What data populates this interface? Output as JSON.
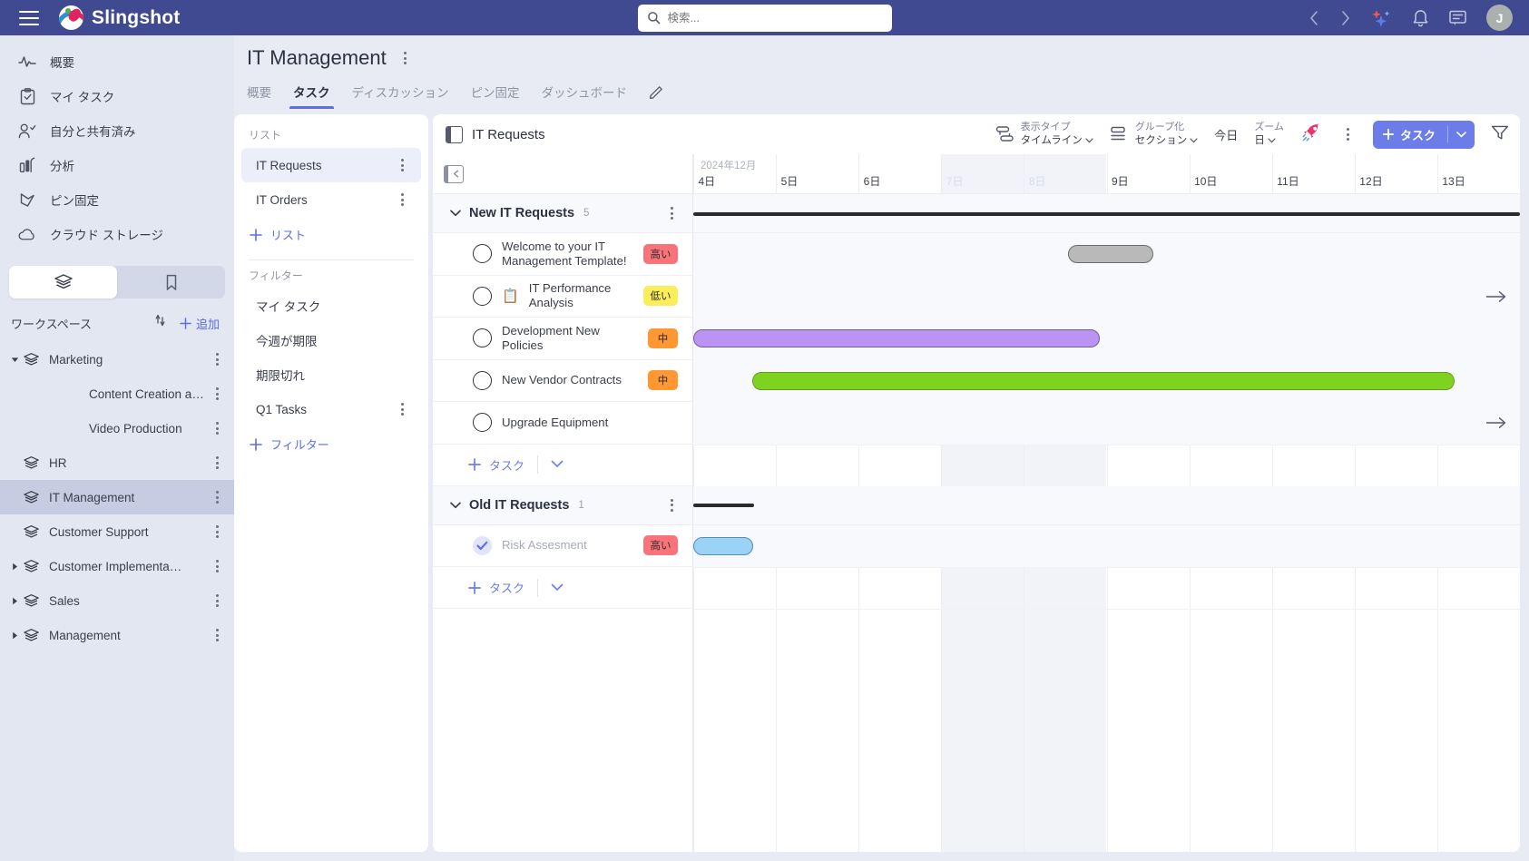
{
  "topbar": {
    "brand": "Slingshot",
    "search_placeholder": "検索...",
    "avatar_initial": "J",
    "icons": {
      "menu": "hamburger-icon",
      "search": "search-icon",
      "back": "chevron-left-icon",
      "forward": "chevron-right-icon",
      "ai": "ai-sparkle-icon",
      "notifications": "bell-icon",
      "chat": "chat-icon"
    },
    "bg": "#3f4a91"
  },
  "sidebar": {
    "nav": [
      {
        "label": "概要",
        "icon": "activity-icon"
      },
      {
        "label": "マイ タスク",
        "icon": "clipboard-check-icon"
      },
      {
        "label": "自分と共有済み",
        "icon": "user-check-icon"
      },
      {
        "label": "分析",
        "icon": "bar-chart-icon"
      },
      {
        "label": "ピン固定",
        "icon": "pin-icon"
      },
      {
        "label": "クラウド ストレージ",
        "icon": "cloud-icon"
      }
    ],
    "segments": [
      {
        "icon": "layers-icon",
        "active": true
      },
      {
        "icon": "bookmark-icon",
        "active": false
      }
    ],
    "workspace_title": "ワークスペース",
    "sort_icon": "sort-arrows-icon",
    "add_label": "追加",
    "tree": [
      {
        "label": "Marketing",
        "level": 0,
        "caret": "down",
        "selected": false
      },
      {
        "label": "Content Creation an…",
        "level": 1,
        "caret": "none",
        "selected": false
      },
      {
        "label": "Video Production",
        "level": 1,
        "caret": "none",
        "selected": false
      },
      {
        "label": "HR",
        "level": 0,
        "caret": "none",
        "selected": false
      },
      {
        "label": "IT Management",
        "level": 0,
        "caret": "none",
        "selected": true
      },
      {
        "label": "Customer Support",
        "level": 0,
        "caret": "none",
        "selected": false
      },
      {
        "label": "Customer Implementa…",
        "level": 0,
        "caret": "right",
        "selected": false
      },
      {
        "label": "Sales",
        "level": 0,
        "caret": "right",
        "selected": false
      },
      {
        "label": "Management",
        "level": 0,
        "caret": "right",
        "selected": false
      }
    ]
  },
  "project": {
    "title": "IT Management",
    "tabs": [
      {
        "label": "概要",
        "active": false
      },
      {
        "label": "タスク",
        "active": true
      },
      {
        "label": "ディスカッション",
        "active": false
      },
      {
        "label": "ピン固定",
        "active": false
      },
      {
        "label": "ダッシュボード",
        "active": false
      }
    ],
    "edit_icon": "pencil-icon"
  },
  "lists_panel": {
    "lists_header": "リスト",
    "lists": [
      {
        "label": "IT Requests",
        "selected": true
      },
      {
        "label": "IT Orders",
        "selected": false
      }
    ],
    "add_list_label": "リスト",
    "filters_header": "フィルター",
    "filters": [
      {
        "label": "マイ タスク",
        "kebab": false
      },
      {
        "label": "今週が期限",
        "kebab": false
      },
      {
        "label": "期限切れ",
        "kebab": false
      },
      {
        "label": "Q1 Tasks",
        "kebab": true
      }
    ],
    "add_filter_label": "フィルター"
  },
  "gantt": {
    "title": "IT Requests",
    "toolbar": {
      "view_type_label": "表示タイプ",
      "view_type_value": "タイムライン",
      "group_by_label": "グループ化",
      "group_by_value": "セクション",
      "today_label": "今日",
      "zoom_label": "ズーム",
      "zoom_value": "日",
      "rocket_icon": "rocket-icon",
      "more_icon": "more-vertical-icon",
      "add_task_label": "タスク",
      "add_task_caret": "chevron-down-icon",
      "filter_icon": "filter-icon",
      "accent": "#6c7ce8"
    },
    "timeline": {
      "month": "2024年12月",
      "days": [
        {
          "label": "4日",
          "weekend": false
        },
        {
          "label": "5日",
          "weekend": false
        },
        {
          "label": "6日",
          "weekend": false
        },
        {
          "label": "7日",
          "weekend": true
        },
        {
          "label": "8日",
          "weekend": true
        },
        {
          "label": "9日",
          "weekend": false
        },
        {
          "label": "10日",
          "weekend": false
        },
        {
          "label": "11日",
          "weekend": false
        },
        {
          "label": "12日",
          "weekend": false
        },
        {
          "label": "13日",
          "weekend": false
        }
      ]
    },
    "sections": [
      {
        "name": "New IT Requests",
        "count": "5",
        "bar": {
          "start_pct": 0,
          "end_pct": 100
        },
        "tasks": [
          {
            "name": "Welcome to your IT Management Template!",
            "emoji": "",
            "priority": "高い",
            "priority_color": "#f9737a",
            "done": false,
            "bar": {
              "color": "gray",
              "start_pct": 45.3,
              "width_pct": 10.3
            },
            "arrow": false
          },
          {
            "name": "IT Performance Analysis",
            "emoji": "📋",
            "priority": "低い",
            "priority_color": "#fcee5b",
            "done": false,
            "bar": null,
            "arrow": true
          },
          {
            "name": "Development New Policies",
            "emoji": "",
            "priority": "中",
            "priority_color": "#ff9833",
            "done": false,
            "bar": {
              "color": "purple",
              "start_pct": 0,
              "width_pct": 49.2
            },
            "arrow": false
          },
          {
            "name": "New Vendor Contracts",
            "emoji": "",
            "priority": "中",
            "priority_color": "#ff9833",
            "done": false,
            "bar": {
              "color": "green",
              "start_pct": 7.1,
              "width_pct": 85.0
            },
            "arrow": false
          },
          {
            "name": "Upgrade Equipment",
            "emoji": "",
            "priority": "",
            "priority_color": "",
            "done": false,
            "bar": null,
            "arrow": true
          }
        ],
        "add_task_label": "タスク"
      },
      {
        "name": "Old IT Requests",
        "count": "1",
        "bar": {
          "start_pct": 0,
          "end_pct": 7.3
        },
        "tasks": [
          {
            "name": "Risk Assesment",
            "emoji": "",
            "priority": "高い",
            "priority_color": "#f9737a",
            "done": true,
            "bar": {
              "color": "blue",
              "start_pct": 0,
              "width_pct": 7.2
            },
            "arrow": false
          }
        ],
        "add_task_label": "タスク"
      }
    ]
  }
}
